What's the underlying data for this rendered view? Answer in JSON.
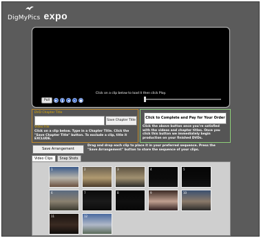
{
  "logo": {
    "brand": "DigMyPics",
    "product": "expo"
  },
  "player": {
    "message": "Click on a clip below to load it then click Play.",
    "pull_label": "Pull",
    "control_icons": [
      "play-icon",
      "pause-icon",
      "previous-icon",
      "next-icon",
      "stop-icon"
    ]
  },
  "chapter": {
    "section_title": "DVD Chapter Title",
    "input_value": "",
    "save_button": "Save Chapter Title",
    "video_file_label": "Video File",
    "instructions": "Click on a clip below.  Type in a Chapter Title. Click the \"Save Chapter Title\" button. To exclude a clip, title it EXCLUDE."
  },
  "payment": {
    "button": "Click to Complete and Pay for Your Order",
    "note": "Click the above button once you're satisfied with the videos and chapter titles.  Once you click this button we immediately begin production on your finished DVDs."
  },
  "arrange": {
    "button": "Save Arrangement",
    "instructions": "Drag and drop each clip to place it in your preferred sequence.  Press the \"Save Arrangement\" button to store the sequence of your clips."
  },
  "tabs": [
    {
      "label": "Video Clips",
      "active": true
    },
    {
      "label": "Snap Shots",
      "active": false
    }
  ],
  "clips": [
    {
      "number": "1",
      "colors": [
        "#3a5a8a",
        "#b8b4aa",
        "#6a5040"
      ]
    },
    {
      "number": "2",
      "colors": [
        "#6a6050",
        "#b09a70",
        "#4a3a2a"
      ]
    },
    {
      "number": "3",
      "colors": [
        "#5a5040",
        "#a09070",
        "#2a2a28"
      ]
    },
    {
      "number": "4",
      "colors": [
        "#080808",
        "#0a0a0a",
        "#141414"
      ]
    },
    {
      "number": "5",
      "colors": [
        "#050505",
        "#0a0a0a",
        "#121212"
      ]
    },
    {
      "number": "6",
      "colors": [
        "#5a6a80",
        "#8a8070",
        "#3a3a30"
      ]
    },
    {
      "number": "7",
      "colors": [
        "#0a0a0a",
        "#1a1a1a",
        "#0c0c0c"
      ]
    },
    {
      "number": "8",
      "colors": [
        "#060606",
        "#101010",
        "#080808"
      ]
    },
    {
      "number": "9",
      "colors": [
        "#3a2a24",
        "#c0a090",
        "#302020"
      ]
    },
    {
      "number": "10",
      "colors": [
        "#3a5070",
        "#8a7a6a",
        "#2a2a2a"
      ]
    },
    {
      "number": "11",
      "colors": [
        "#1a1410",
        "#3a2a22",
        "#0e0c0a"
      ]
    },
    {
      "number": "12",
      "colors": [
        "#4a6aa0",
        "#b0b8c8",
        "#5a6a58"
      ]
    }
  ]
}
